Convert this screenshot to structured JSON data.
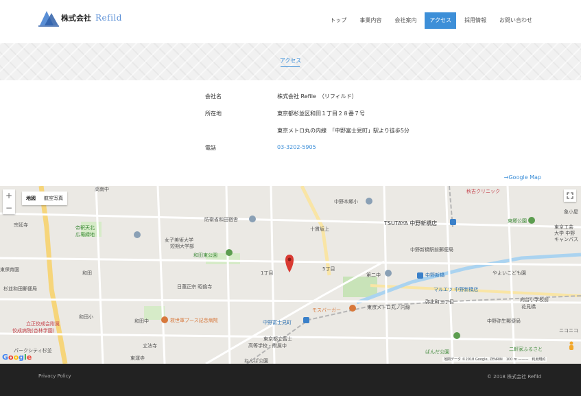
{
  "header": {
    "logo_jp": "株式会社",
    "logo_en": "Refild",
    "nav": [
      "トップ",
      "事業内容",
      "会社案内",
      "アクセス",
      "採用情報",
      "お問い合わせ"
    ],
    "active_nav": "アクセス"
  },
  "hero": {
    "title": "アクセス"
  },
  "info": {
    "company_label": "会社名",
    "company_value": "株式会社 Refile　（リフィルド）",
    "address_label": "所在地",
    "address_value": "東京都杉並区和田１丁目２８番７号",
    "access_value": "東京メトロ丸の内線　「中野富士見町」駅より徒歩5分",
    "phone_label": "電話",
    "phone_value": "03-3202-5905"
  },
  "google_map_link": "→Google Map",
  "map": {
    "zoom_in": "+",
    "zoom_out": "−",
    "type_map": "地図",
    "type_satellite": "航空写真",
    "google": "Google",
    "attribution": "地図データ ©2018 Google, ZENRIN　100 m ———　利用規約",
    "labels": [
      "高南中",
      "中野本郷小",
      "秋吉クリニック",
      "宗延寺",
      "帝釈天北",
      "広場緑地",
      "防衛省和田宿舎",
      "十貫坂上",
      "TSUTAYA 中野新橋店",
      "東郷公園",
      "象小屋",
      "女子美術大学",
      "短期大学部",
      "和田東公園",
      "中野新橋駅前郵便局",
      "東京工芸",
      "大学 中野",
      "キャンパス",
      "東保育園",
      "杉並和田郵便局",
      "和田",
      "1丁目",
      "5丁目",
      "第二中",
      "中野新橋",
      "やよいこども園",
      "日蓮正宗 昭倫寺",
      "マルエツ 中野新橋店",
      "立正佼成会附属",
      "佼成病院(杏林学園)",
      "モスバーガー",
      "東京メトロ丸ノ内線",
      "弥生町三丁目",
      "向台小学校前",
      "花見橋",
      "和田小",
      "和田中",
      "救世軍ブース記念病院",
      "中野富士見町",
      "中野弥生郵便局",
      "パークシティ杉並",
      "立法寺",
      "東京都立富士",
      "高等学校・附属中",
      "ばんだ公園",
      "東運寺",
      "ねんぱ公園",
      "二軒家ふるさと",
      "ニコニコ"
    ]
  },
  "footer": {
    "privacy": "Privacy Policy",
    "copyright": "© 2018 株式会社 Refild"
  },
  "colors": {
    "accent": "#3d8fd8",
    "footer_bg": "#222222",
    "marker": "#d93a32"
  }
}
